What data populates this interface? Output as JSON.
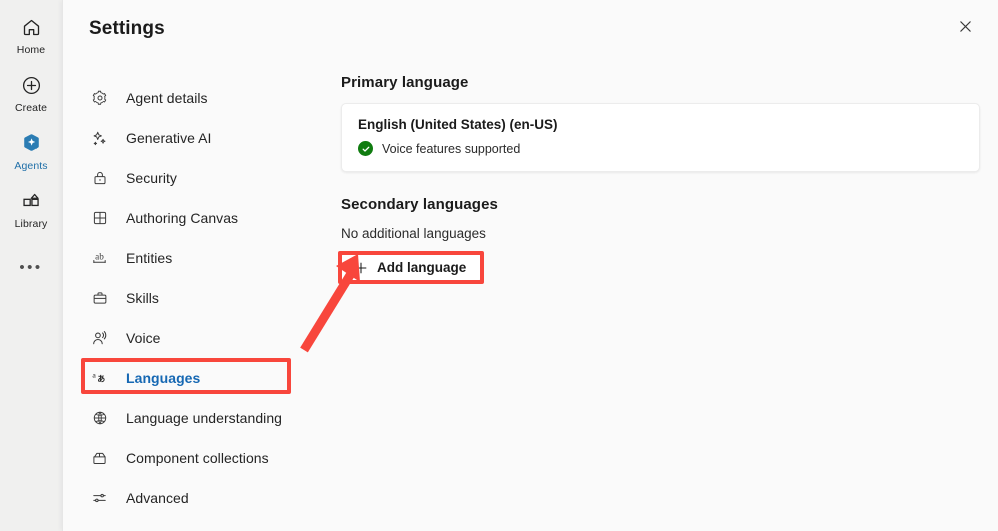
{
  "rail": {
    "items": [
      {
        "label": "Home",
        "icon": "home-icon",
        "active": false
      },
      {
        "label": "Create",
        "icon": "plus-circle-icon",
        "active": false
      },
      {
        "label": "Agents",
        "icon": "agents-hexagon-sparkle-icon",
        "active": true
      },
      {
        "label": "Library",
        "icon": "library-grid-icon",
        "active": false
      }
    ],
    "more_label": "•••"
  },
  "header": {
    "title": "Settings",
    "close_icon": "close-icon"
  },
  "settings_nav": {
    "items": [
      {
        "label": "Agent details",
        "icon": "gear-icon"
      },
      {
        "label": "Generative AI",
        "icon": "sparkle-icon"
      },
      {
        "label": "Security",
        "icon": "lock-icon"
      },
      {
        "label": "Authoring Canvas",
        "icon": "grid-canvas-icon"
      },
      {
        "label": "Entities",
        "icon": "ab-underline-icon"
      },
      {
        "label": "Skills",
        "icon": "briefcase-icon"
      },
      {
        "label": "Voice",
        "icon": "person-voice-icon"
      },
      {
        "label": "Languages",
        "icon": "translate-icon",
        "selected": true
      },
      {
        "label": "Language understanding",
        "icon": "globe-brain-icon"
      },
      {
        "label": "Component collections",
        "icon": "component-box-icon"
      },
      {
        "label": "Advanced",
        "icon": "sliders-icon"
      }
    ]
  },
  "content": {
    "primary": {
      "section_title": "Primary language",
      "language_name": "English (United States) (en-US)",
      "voice_status": "Voice features supported",
      "voice_status_icon": "checkmark-circle-icon",
      "voice_status_color": "#107C10"
    },
    "secondary": {
      "section_title": "Secondary languages",
      "empty_text": "No additional languages",
      "add_button_label": "Add language",
      "add_button_icon": "plus-icon"
    }
  },
  "annotations": {
    "color": "#F8463C",
    "highlight_languages_nav": true,
    "highlight_add_language_button": true,
    "arrow_from": "languages-nav-item",
    "arrow_to": "add-language-button"
  },
  "colors": {
    "accent_blue": "#1668B3",
    "rail_background": "#F0F0EF",
    "panel_background": "#FAFAFA",
    "card_background": "#FFFFFF",
    "annotation_red": "#F8463C",
    "success_green": "#107C10"
  }
}
